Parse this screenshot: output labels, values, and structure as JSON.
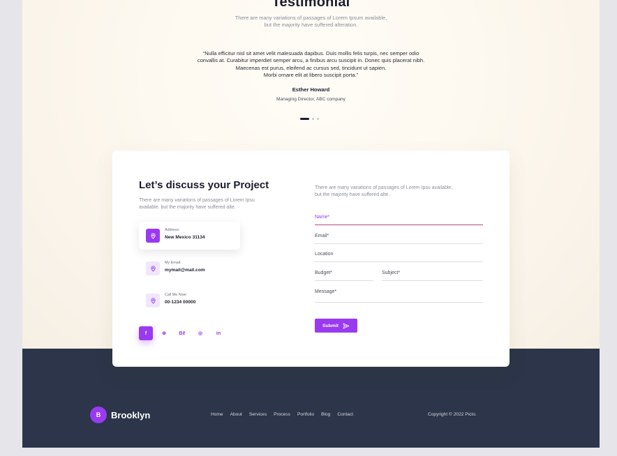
{
  "testimonial": {
    "title": "Testimonial",
    "subtitle_lines": [
      "There are many variations of passages of Lorem Ipsum available,",
      "but the majority have suffered alteration."
    ],
    "quote_lines": [
      "“Nulla efficitur nisl sit amet velit malesuada dapibus. Duis mollis felis turpis, nec semper odio",
      "convallis at. Curabitur imperdiet semper arcu, a finibus arcu suscipit in. Donec quis placerat nibh.",
      "Maecenas est purus, eleifend ac cursus sed, tincidunt ut sapien.",
      "Morbi ornare elit at libero suscipit porta.”"
    ],
    "author": "Esther Howard",
    "role": "Managing Director, ABC company",
    "active_slide": 1,
    "slide_count": 3
  },
  "contact": {
    "title": "Let’s discuss your Project",
    "subtitle_lines": [
      "There are many variations of passages of Lorem Ipsu",
      "available. but the majority have suffered alte."
    ],
    "info": [
      {
        "label": "Address:",
        "value": "New Mexico 31134",
        "icon": "location-pin-icon"
      },
      {
        "label": "My Email:",
        "value": "mymail@mail.com",
        "icon": "location-pin-icon"
      },
      {
        "label": "Call Me Now:",
        "value": "00-1234 00000",
        "icon": "location-pin-icon"
      }
    ],
    "socials": [
      {
        "name": "facebook",
        "glyph": "f"
      },
      {
        "name": "dribbble",
        "glyph": "⊛"
      },
      {
        "name": "behance",
        "glyph": "Bē"
      },
      {
        "name": "instagram",
        "glyph": "◎"
      },
      {
        "name": "linkedin",
        "glyph": "in"
      }
    ],
    "form": {
      "description_lines": [
        "There are many variations of passages of Lorem Ipsu available,",
        "but the majority have suffered alte."
      ],
      "name_placeholder": "Name*",
      "email_placeholder": "Email*",
      "location_placeholder": "Location",
      "budget_placeholder": "Budget*",
      "subject_placeholder": "Subject*",
      "message_placeholder": "Message*",
      "submit_label": "Submit"
    }
  },
  "footer": {
    "logo_letter": "B",
    "brand": "Brooklyn",
    "nav": [
      "Home",
      "About",
      "Services",
      "Process",
      "Portfolio",
      "Blog",
      "Contact"
    ],
    "copyright": "Copyright © 2022 Picto."
  },
  "colors": {
    "accent": "#9a3af0",
    "footer_bg": "#2c3549",
    "dark_text": "#1b1d2e"
  }
}
